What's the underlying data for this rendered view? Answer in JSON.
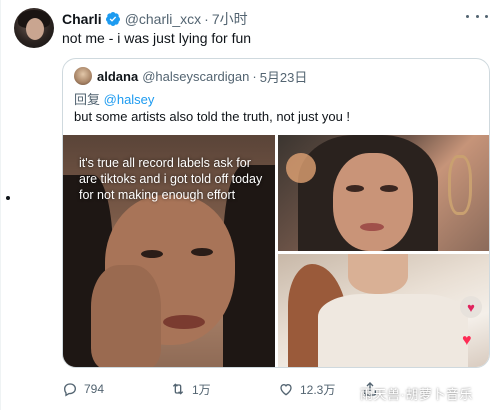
{
  "tweet": {
    "author": {
      "display_name": "Charli",
      "handle": "@charli_xcx",
      "verified": true,
      "avatar_icon": "avatar"
    },
    "separator": "·",
    "time": "7小时",
    "text": "not me - i was just lying for fun",
    "more_icon": "more-horizontal-icon"
  },
  "quote": {
    "author": {
      "display_name": "aldana",
      "handle": "@halseyscardigan"
    },
    "separator": "·",
    "date": "5月23日",
    "reply_prefix": "回复",
    "reply_mention": "@halsey",
    "text": "but some artists also told the truth, not just you !",
    "media_overlay_text": "it's true all record labels ask for are tiktoks and i got told off today for not making enough effort"
  },
  "actions": {
    "reply": {
      "icon": "reply-icon",
      "count": "794"
    },
    "retweet": {
      "icon": "retweet-icon",
      "count": "1万"
    },
    "like": {
      "icon": "heart-icon",
      "count": "12.3万"
    },
    "share": {
      "icon": "share-icon"
    }
  },
  "watermark": "雨天兽·胡萝卜音乐",
  "colors": {
    "accent": "#1d9bf0",
    "text_primary": "#0f1419",
    "text_secondary": "#536471",
    "border": "#cfd9de"
  }
}
